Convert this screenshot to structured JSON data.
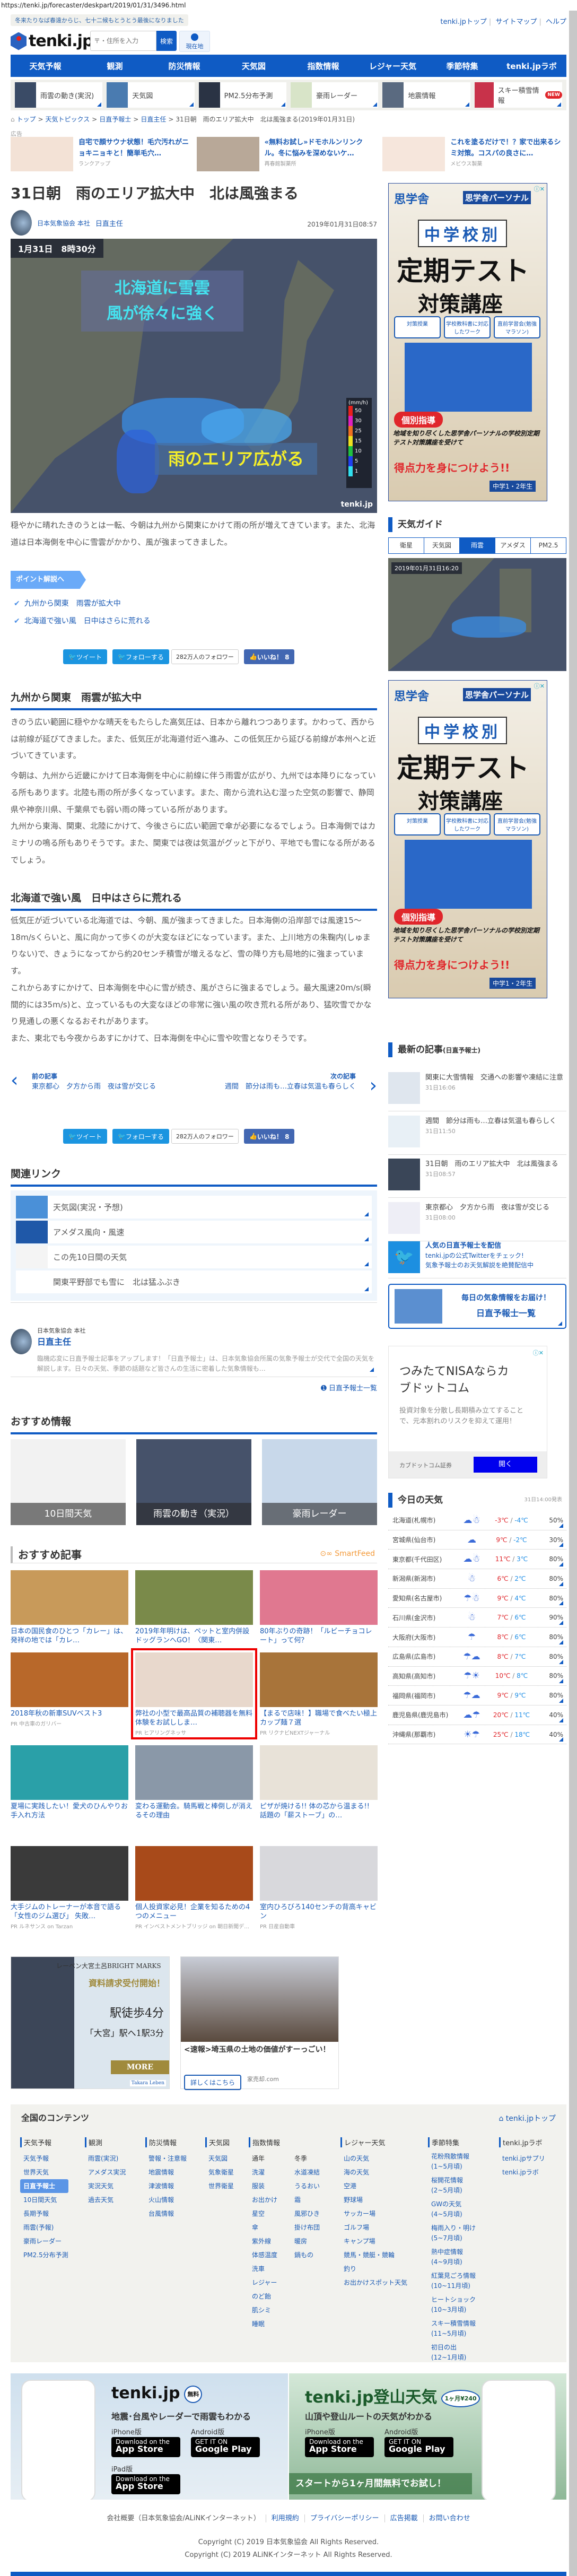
{
  "browser": {
    "url": "https://tenki.jp/forecaster/deskpart/2019/01/31/3496.html"
  },
  "header": {
    "tagline": "冬来たりなば春遠からじ、七十二候もとうとう最後になりました",
    "top_links": [
      "tenki.jpトップ",
      "サイトマップ",
      "ヘルプ"
    ],
    "logo": "tenki.jp",
    "search_placeholder": "〒・住所を入力",
    "search_button": "検索",
    "location_button": "現在地",
    "nav": [
      "天気予報",
      "観測",
      "防災情報",
      "天気図",
      "指数情報",
      "レジャー天気",
      "季節特集",
      "tenki.jpラボ"
    ],
    "quick_links": [
      {
        "label": "雨雲の動き(実況)"
      },
      {
        "label": "天気図"
      },
      {
        "label": "PM2.5分布予測"
      },
      {
        "label": "豪雨レーダー"
      },
      {
        "label": "地震情報"
      },
      {
        "label": "スキー積雪情報",
        "badge": "NEW"
      }
    ]
  },
  "breadcrumb": [
    "トップ",
    "天気トピックス",
    "日直予報士",
    "日直主任",
    "31日朝　雨のエリア拡大中　北は風強まる(2019年01月31日)"
  ],
  "top_ads": {
    "label": "広告",
    "items": [
      {
        "title": "自宅で顔サウナ状態！毛穴汚れがニョキニョキと！簡単毛穴…",
        "source": "ランクアップ"
      },
      {
        "title": "«無料お試し»ドモホルンリンクル。冬に悩みを深めないケ…",
        "source": "再春館製薬所"
      },
      {
        "title": "これを塗るだけで！？家で出来るシミ対策。コスパの良さに…",
        "source": "メビウス製薬"
      }
    ]
  },
  "article": {
    "title": "31日朝　雨のエリア拡大中　北は風強まる",
    "author_org": "日本気象協会 本社",
    "author_name": "日直主任",
    "date": "2019年01月31日08:57",
    "map": {
      "time": "1月31日　8時30分",
      "caption1": "北海道に雪雲\n風が徐々に強く",
      "caption1_l1": "北海道に雪雲",
      "caption1_l2": "風が徐々に強く",
      "caption2": "雨のエリア広がる",
      "legend_unit": "(mm/h)",
      "legend": [
        "50",
        "30",
        "25",
        "15",
        "10",
        "5",
        "1"
      ],
      "watermark": "tenki.jp"
    },
    "intro": "穏やかに晴れたきのうとは一転、今朝は九州から関東にかけて雨の所が増えてきています。また、北海道は日本海側を中心に雪雲がかかり、風が強まってきました。",
    "point_button": "ポイント解説へ",
    "points": [
      "九州から関東　雨雲が拡大中",
      "北海道で強い風　日中はさらに荒れる"
    ],
    "sections": [
      {
        "heading": "九州から関東　雨雲が拡大中",
        "paragraphs": [
          "きのう広い範囲に穏やかな晴天をもたらした高気圧は、日本から離れつつあります。かわって、西からは前線が延びてきました。また、低気圧が北海道付近へ進み、この低気圧から延びる前線が本州へと近づいてきています。",
          "今朝は、九州から近畿にかけて日本海側を中心に前線に伴う雨雲が広がり、九州では本降りになっている所もあります。北陸も雨の所が多くなっています。また、南から流れ込む湿った空気の影響で、静岡県や神奈川県、千葉県でも弱い雨の降っている所があります。",
          "九州から東海、関東、北陸にかけて、今後さらに広い範囲で傘が必要になるでしょう。日本海側ではカミナリの鳴る所もありそうです。また、関東では夜は気温がグッと下がり、平地でも雪になる所があるでしょう。"
        ]
      },
      {
        "heading": "北海道で強い風　日中はさらに荒れる",
        "paragraphs": [
          "低気圧が近づいている北海道では、今朝、風が強まってきました。日本海側の沿岸部では風速15～18m/sくらいと、風に向かって歩くのが大変なほどになっています。また、上川地方の朱鞠内(しゅまりない)で、きょうになってから約20センチ積雪が増えるなど、雪の降り方も局地的に強まっています。",
          "これからあすにかけて、日本海側を中心に雪が続き、風がさらに強まるでしょう。最大風速20m/s(瞬間的には35m/s)と、立っているもの大変なほどの非常に強い風の吹き荒れる所があり、猛吹雪でかなり見通しの悪くなるおそれがあります。",
          "また、東北でも今夜からあすにかけて、日本海側を中心に雪や吹雪となりそうです。"
        ]
      }
    ],
    "social": {
      "tweet": "ツイート",
      "follow": "フォローする",
      "followers": "282万人のフォロワー",
      "like": "いいね！ 8"
    },
    "prev": {
      "label": "前の記事",
      "title": "東京都心　夕方から雨　夜は雪が交じる"
    },
    "next": {
      "label": "次の記事",
      "title": "週間　節分は雨も…立春は気温も春らしく"
    }
  },
  "related": {
    "heading": "関連リンク",
    "items": [
      "天気図(実況・予想)",
      "アメダス風向・風速",
      "この先10日間の天気",
      "関東平野部でも雪に　北は猛ふぶき"
    ]
  },
  "author_box": {
    "org": "日本気象協会 本社",
    "name": "日直主任",
    "desc": "臨機応変に日直予報士記事をアップします！「日直予報士」は、日本気象協会所属の気象予報士が交代で全国の天気を解説します。日々の天気、季節の話題など皆さんの生活に密着した気象情報も…",
    "list_link": "日直予報士一覧"
  },
  "recommend_info": {
    "heading": "おすすめ情報",
    "tiles": [
      "10日間天気",
      "雨雲の動き（実況）",
      "豪雨レーダー"
    ]
  },
  "recommend_articles": {
    "heading": "おすすめ記事",
    "provider": "SmartFeed",
    "items": [
      {
        "title": "日本の国民食のひとつ「カレー」は、発祥の地では「カレ…",
        "pr": ""
      },
      {
        "title": "2019年年明けは、ペットと室内併設ドッグランへGO！〈関東…",
        "pr": ""
      },
      {
        "title": "80年ぶりの奇跡！「ルビーチョコレート」って何？",
        "pr": ""
      },
      {
        "title": "2018年秋の新車SUVベスト3",
        "pr": "PR 中古車のガリバー"
      },
      {
        "title": "弊社の小型で最高品質の補聴器を無料体験をお試ししま…",
        "pr": "PR ヒアリングネッサ",
        "highlight": true
      },
      {
        "title": "【まるで店味！】職場で食べたい極上カップ麺７選",
        "pr": "PR リクナビNEXTジャーナル"
      },
      {
        "title": "夏場に実践したい！愛犬のひんやりお手入れ方法",
        "pr": ""
      },
      {
        "title": "変わる運動会。騎馬戦と棒倒しが消えるその理由",
        "pr": ""
      },
      {
        "title": "ピザが焼ける!! 体の芯から温まる!! 話題の「薪ストーブ」の…",
        "pr": ""
      },
      {
        "title": "大手ジムのトレーナーが本音で語る「女性のジム選び」 失敗…",
        "pr": "PR ルネサンス on Tarzan"
      },
      {
        "title": "個人投資家必見！企業を知るための4つのメニュー",
        "pr": "PR インベストメントブリッジ on 朝日新聞デ…"
      },
      {
        "title": "室内ひろびろ140センチの背高キャビン",
        "pr": "PR 日産自動車"
      }
    ]
  },
  "bottom_ads": {
    "left": {
      "l1": "レーベン大宮土呂BRIGHT MARKS",
      "l2": "資料請求受付開始！",
      "l3": "駅徒歩4分",
      "l4": "「大宮」駅へ1駅3分",
      "more": "MORE",
      "brand": "Takara Leben"
    },
    "right": {
      "title": "<速報>埼玉県の土地の価値がすーっごい！",
      "button": "詳しくはこちら",
      "source": "家売却.com"
    }
  },
  "sidebar": {
    "ad1": {
      "brand": "思学舎",
      "brand2": "思学舎パーソナル",
      "l1": "中学校別",
      "l2": "定期テスト",
      "l3": "対策講座",
      "chips": [
        "対策授業",
        "学校教科書に対応したワーク",
        "直前学習会(勉強マラソン)"
      ],
      "tag": "個別指導",
      "copy": "地域を知り尽くした思学舎パーソナルの学校別定期テスト対策講座を受けて",
      "cta": "得点力を身につけよう!!",
      "grade": "中学1・2年生"
    },
    "guide": {
      "heading": "天気ガイド",
      "tabs": [
        "衛星",
        "天気図",
        "雨雲",
        "アメダス",
        "PM2.5"
      ],
      "active": 2,
      "time": "2019年01月31日16:20"
    },
    "latest": {
      "heading": "最新の記事",
      "sub": "(日直予報士)",
      "items": [
        {
          "title": "関東に大雪情報　交通への影響や凍結に注意",
          "date": "31日16:06"
        },
        {
          "title": "週間　節分は雨も…立春は気温も春らしく",
          "date": "31日11:50"
        },
        {
          "title": "31日朝　雨のエリア拡大中　北は風強まる",
          "date": "31日08:57"
        },
        {
          "title": "東京都心　夕方から雨　夜は雪が交じる",
          "date": "31日08:00"
        }
      ],
      "twitter": {
        "title": "人気の日直予報士を配信",
        "l1": "tenki.jpの公式Twitterをチェック!",
        "l2": "気象予報士のお天気解説を絶賛配信中"
      },
      "banner": {
        "title": "毎日の気象情報をお届け！",
        "sub": "日直予報士一覧"
      }
    },
    "nisa_ad": {
      "title": "つみたてNISAならカブドットコム",
      "desc": "投資対象を分散し長期積み立てすることで、元本割れのリスクを抑えて運用！",
      "advertiser": "カブドットコム証券",
      "button": "開く"
    },
    "today": {
      "heading": "今日の天気",
      "issued": "31日14:00発表",
      "rows": [
        {
          "city": "北海道(札幌市)",
          "icon": "cloud-snow",
          "hi": "-3℃",
          "lo": "-4℃",
          "pop": "50%"
        },
        {
          "city": "宮城県(仙台市)",
          "icon": "cloud",
          "hi": "9℃",
          "lo": "-2℃",
          "pop": "30%"
        },
        {
          "city": "東京都(千代田区)",
          "icon": "cloud-snow",
          "hi": "11℃",
          "lo": "3℃",
          "pop": "80%"
        },
        {
          "city": "新潟県(新潟市)",
          "icon": "snow",
          "hi": "6℃",
          "lo": "2℃",
          "pop": "80%"
        },
        {
          "city": "愛知県(名古屋市)",
          "icon": "rain-snow",
          "hi": "9℃",
          "lo": "4℃",
          "pop": "80%"
        },
        {
          "city": "石川県(金沢市)",
          "icon": "snow",
          "hi": "7℃",
          "lo": "6℃",
          "pop": "90%"
        },
        {
          "city": "大阪府(大阪市)",
          "icon": "rain",
          "hi": "8℃",
          "lo": "6℃",
          "pop": "80%"
        },
        {
          "city": "広島県(広島市)",
          "icon": "rain-cloud",
          "hi": "8℃",
          "lo": "7℃",
          "pop": "80%"
        },
        {
          "city": "高知県(高知市)",
          "icon": "rain-sun",
          "hi": "10℃",
          "lo": "8℃",
          "pop": "80%"
        },
        {
          "city": "福岡県(福岡市)",
          "icon": "rain-cloud",
          "hi": "9℃",
          "lo": "9℃",
          "pop": "80%"
        },
        {
          "city": "鹿児島県(鹿児島市)",
          "icon": "cloud-rain",
          "hi": "20℃",
          "lo": "11℃",
          "pop": "40%"
        },
        {
          "city": "沖縄県(那覇市)",
          "icon": "sun-rain",
          "hi": "25℃",
          "lo": "18℃",
          "pop": "40%"
        }
      ]
    }
  },
  "footer": {
    "heading": "全国のコンテンツ",
    "top_link": "tenki.jpトップ",
    "columns": [
      {
        "title": "天気予報",
        "items": [
          "天気予報",
          "世界天気",
          "日直予報士",
          "10日間天気",
          "長期予報",
          "雨雲(予報)",
          "豪雨レーダー",
          "PM2.5分布予測"
        ],
        "active": 2
      },
      {
        "title": "観測",
        "items": [
          "雨雲(実況)",
          "アメダス実況",
          "実況天気",
          "過去天気"
        ]
      },
      {
        "title": "防災情報",
        "items": [
          "警報・注意報",
          "地震情報",
          "津波情報",
          "火山情報",
          "台風情報"
        ]
      },
      {
        "title": "天気図",
        "items": [
          "天気図",
          "気象衛星",
          "世界衛星"
        ]
      },
      {
        "title": "指数情報",
        "sub": [
          "通年",
          "冬季"
        ],
        "items": [
          "洗濯",
          "服装",
          "お出かけ",
          "星空",
          "傘",
          "紫外線",
          "体感温度",
          "洗車",
          "レジャー",
          "のど飴",
          "肌シミ",
          "睡眠"
        ],
        "items2": [
          "水道凍結",
          "うるおい",
          "霜",
          "風邪ひき",
          "掛け布団",
          "暖房",
          "鍋もの"
        ]
      },
      {
        "title": "レジャー天気",
        "items": [
          "山の天気",
          "海の天気",
          "空港",
          "野球場",
          "サッカー場",
          "ゴルフ場",
          "キャンプ場",
          "競馬・競艇・競輪",
          "釣り",
          "お出かけスポット天気"
        ]
      },
      {
        "title": "季節特集",
        "items": [
          "花粉飛散情報\n(1~5月頃)",
          "桜開花情報\n(2~5月頃)",
          "GWの天気\n(4~5月頃)",
          "梅雨入り・明け\n(5~7月頃)",
          "熱中症情報\n(4~9月頃)",
          "紅葉見ごろ情報\n(10~11月頃)",
          "ヒートショック\n(10~3月頃)",
          "スキー積雪情報\n(11~5月頃)",
          "初日の出\n(12~1月頃)"
        ]
      },
      {
        "title": "tenki.jpラボ",
        "items": [
          "tenki.jpサプリ",
          "tenki.jpラボ"
        ]
      }
    ],
    "apps": [
      {
        "name": "tenki.jp",
        "badge": "無料",
        "desc": "地震･台風やレーダーで雨雲もわかる",
        "iphone": "iPhone版",
        "android": "Android版",
        "ipad": "iPad版"
      },
      {
        "name": "tenki.jp登山天気",
        "badge": "1ヶ月¥240",
        "desc": "山頂や登山ルートの天気がわかる",
        "iphone": "iPhone版",
        "android": "Android版",
        "promo": "スタートから1ヶ月間無料でお試し！"
      }
    ],
    "store": {
      "apple_small": "Download on the",
      "apple": "App Store",
      "google_small": "GET IT ON",
      "google": "Google Play"
    },
    "links": [
      "会社概要（日本気象協会/ALiNKインターネット）",
      "利用規約",
      "プライバシーポリシー",
      "広告掲載",
      "お問い合わせ"
    ],
    "copyright": [
      "Copyright (C) 2019 日本気象協会 All Rights Reserved.",
      "Copyright (C) 2019 ALiNKインターネット All Rights Reserved."
    ]
  },
  "colors": {
    "brand": "#0f5bc4",
    "link": "#1a5ab4",
    "high": "#e0262b",
    "low": "#1e8ee6",
    "highlight": "#ee0000"
  }
}
